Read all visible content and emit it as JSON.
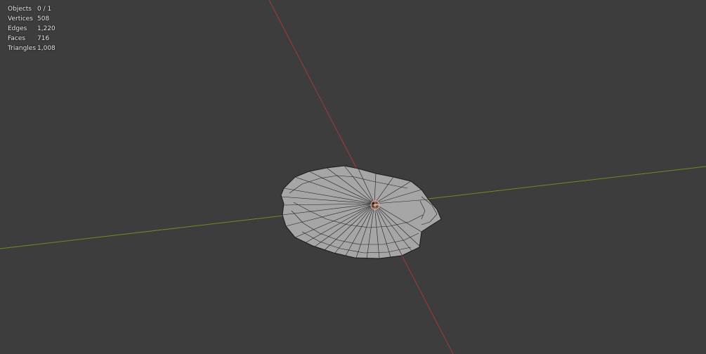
{
  "viewport": {
    "background": "#3d3d3d",
    "x_axis_color": "#a33a3a",
    "y_axis_color": "#6b8e23",
    "mesh_fill": "#a6a6a6",
    "mesh_edge": "#1a1a1a",
    "origin_icon": "object-origin-icon"
  },
  "stats": [
    {
      "label": "Objects",
      "value": "0 / 1"
    },
    {
      "label": "Vertices",
      "value": "508"
    },
    {
      "label": "Edges",
      "value": "1,220"
    },
    {
      "label": "Faces",
      "value": "716"
    },
    {
      "label": "Triangles",
      "value": "1,008"
    }
  ]
}
